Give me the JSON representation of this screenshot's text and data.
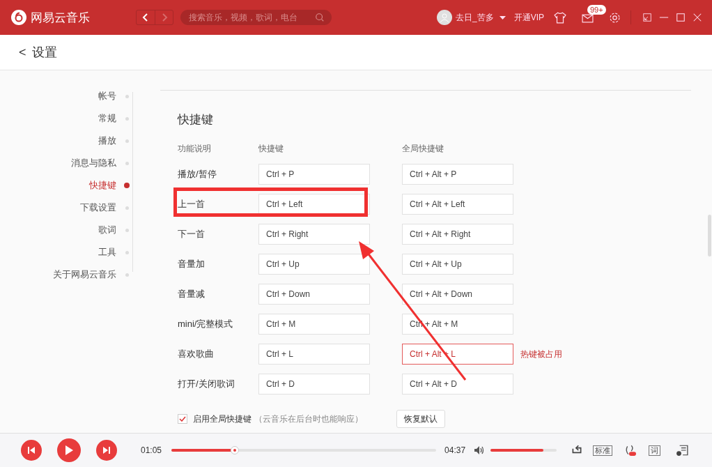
{
  "window": {
    "app_name": "网易云音乐",
    "search": {
      "placeholder": "搜索音乐，视频，歌词，电台"
    },
    "user_name": "去日_苦多",
    "vip": "开通VIP",
    "mail_badge": "99+"
  },
  "page": {
    "back": "<",
    "title": "设置"
  },
  "sidebar": {
    "items": [
      {
        "label": "帐号",
        "selected": false
      },
      {
        "label": "常规",
        "selected": false
      },
      {
        "label": "播放",
        "selected": false
      },
      {
        "label": "消息与隐私",
        "selected": false
      },
      {
        "label": "快捷键",
        "selected": true
      },
      {
        "label": "下载设置",
        "selected": false
      },
      {
        "label": "歌词",
        "selected": false
      },
      {
        "label": "工具",
        "selected": false
      },
      {
        "label": "关于网易云音乐",
        "selected": false
      }
    ]
  },
  "shortcuts": {
    "title": "快捷键",
    "columns": [
      "功能说明",
      "快捷键",
      "全局快捷键"
    ],
    "rows": [
      {
        "action": "播放/暂停",
        "local": "Ctrl + P",
        "global": "Ctrl + Alt + P",
        "conflict": false
      },
      {
        "action": "上一首",
        "local": "Ctrl + Left",
        "global": "Ctrl + Alt + Left",
        "conflict": false
      },
      {
        "action": "下一首",
        "local": "Ctrl + Right",
        "global": "Ctrl + Alt + Right",
        "conflict": false
      },
      {
        "action": "音量加",
        "local": "Ctrl + Up",
        "global": "Ctrl + Alt + Up",
        "conflict": false
      },
      {
        "action": "音量减",
        "local": "Ctrl + Down",
        "global": "Ctrl + Alt + Down",
        "conflict": false
      },
      {
        "action": "mini/完整模式",
        "local": "Ctrl + M",
        "global": "Ctrl + Alt + M",
        "conflict": false
      },
      {
        "action": "喜欢歌曲",
        "local": "Ctrl + L",
        "global": "Ctrl + Alt + L",
        "conflict": true,
        "warning": "热键被占用"
      },
      {
        "action": "打开/关闭歌词",
        "local": "Ctrl + D",
        "global": "Ctrl + Alt + D",
        "conflict": false
      }
    ],
    "global_enabled": {
      "checked": true,
      "label": "启用全局快捷键",
      "note": "（云音乐在后台时也能响应）"
    },
    "reset_button": "恢复默认"
  },
  "player": {
    "elapsed": "01:05",
    "total": "04:37",
    "progress": {
      "level": 0.24
    },
    "volume": {
      "level": 0.8
    },
    "quality": "标准",
    "lyrics": "词"
  }
}
